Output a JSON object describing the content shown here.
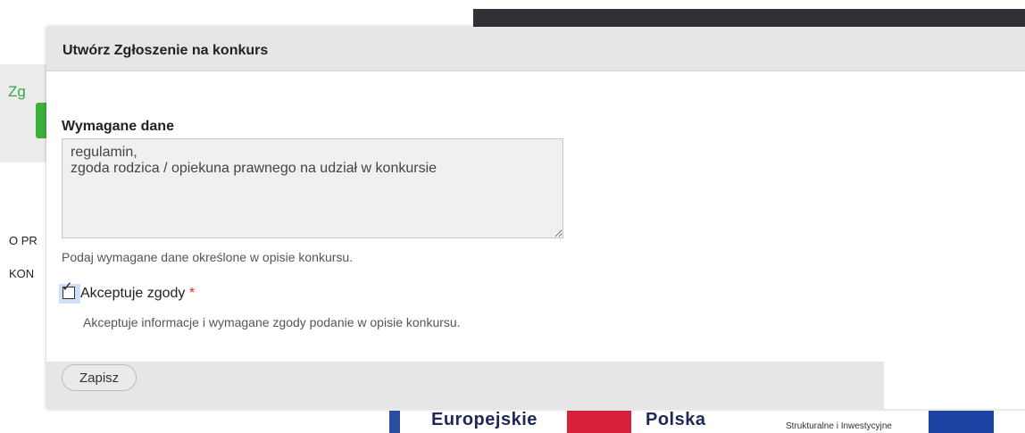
{
  "background": {
    "green_text": "Zg",
    "footer_links": [
      "O PR",
      "KON"
    ],
    "logos": {
      "text_1": "Europejskie",
      "text_2": "Polska",
      "text_3": "Strukturalne i Inwestycyjne"
    }
  },
  "dialog": {
    "title": "Utwórz Zgłoszenie na konkurs",
    "required_data": {
      "label": "Wymagane dane",
      "value": "regulamin,\nzgoda rodzica / opiekuna prawnego na udział w konkursie",
      "description": "Podaj wymagane dane określone w opisie konkursu."
    },
    "consent": {
      "label": "Akceptuje zgody",
      "required_mark": "*",
      "checked": true,
      "description": "Akceptuje informacje i wymagane zgody podanie w opisie konkursu."
    },
    "save_label": "Zapisz"
  },
  "colors": {
    "required": "#d9261c",
    "header_bg": "#e6e6e6",
    "green": "#35a84a"
  }
}
